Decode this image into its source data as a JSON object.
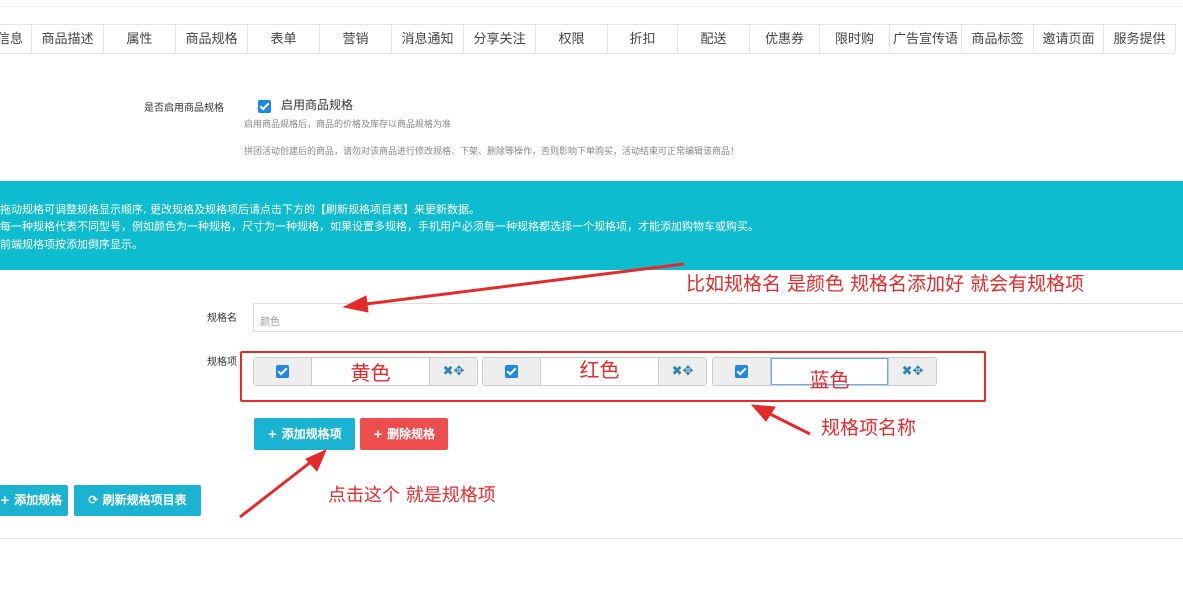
{
  "tabs": [
    "信息",
    "商品描述",
    "属性",
    "商品规格",
    "表单",
    "营销",
    "消息通知",
    "分享关注",
    "权限",
    "折扣",
    "配送",
    "优惠券",
    "限时购",
    "广告宣传语",
    "商品标签",
    "邀请页面",
    "服务提供"
  ],
  "active_tab": 3,
  "enable": {
    "label": "是否启用商品规格",
    "checkbox_text": "启用商品规格",
    "help1": "启用商品规格后，商品的价格及库存以商品规格为准",
    "help2": "拼团活动创建后的商品，请勿对该商品进行修改规格、下架、删除等操作，否则影响下单购买，活动结束可正常编辑该商品！"
  },
  "banner": {
    "line1": "拖动规格可调整规格显示顺序, 更改规格及规格项后请点击下方的【刷新规格项目表】来更新数据。",
    "line2": "每一种规格代表不同型号，例如颜色为一种规格，尺寸为一种规格，如果设置多规格，手机用户必须每一种规格都选择一个规格项，才能添加购物车或购买。",
    "line3": "前端规格项按添加倒序显示。",
    "color": "#0ebccf"
  },
  "spec": {
    "name_label": "规格名",
    "name_value": "颜色",
    "items_label": "规格项",
    "items": [
      {
        "value": "黄色",
        "actions": "✖✥"
      },
      {
        "value": "红色",
        "actions": "✖✥"
      },
      {
        "value": "蓝色",
        "actions": "✖✥"
      }
    ]
  },
  "buttons": {
    "add_item": "+ 添加规格项",
    "delete_spec": "+ 删除规格",
    "add_spec": "+ 添加规格",
    "refresh": "⟳ 刷新规格项目表"
  },
  "annotations": {
    "spec_name_note": "比如规格名 是颜色  规格名添加好 就会有规格项",
    "item_name_note": "规格项名称",
    "click_note": "点击这个 就是规格项"
  }
}
